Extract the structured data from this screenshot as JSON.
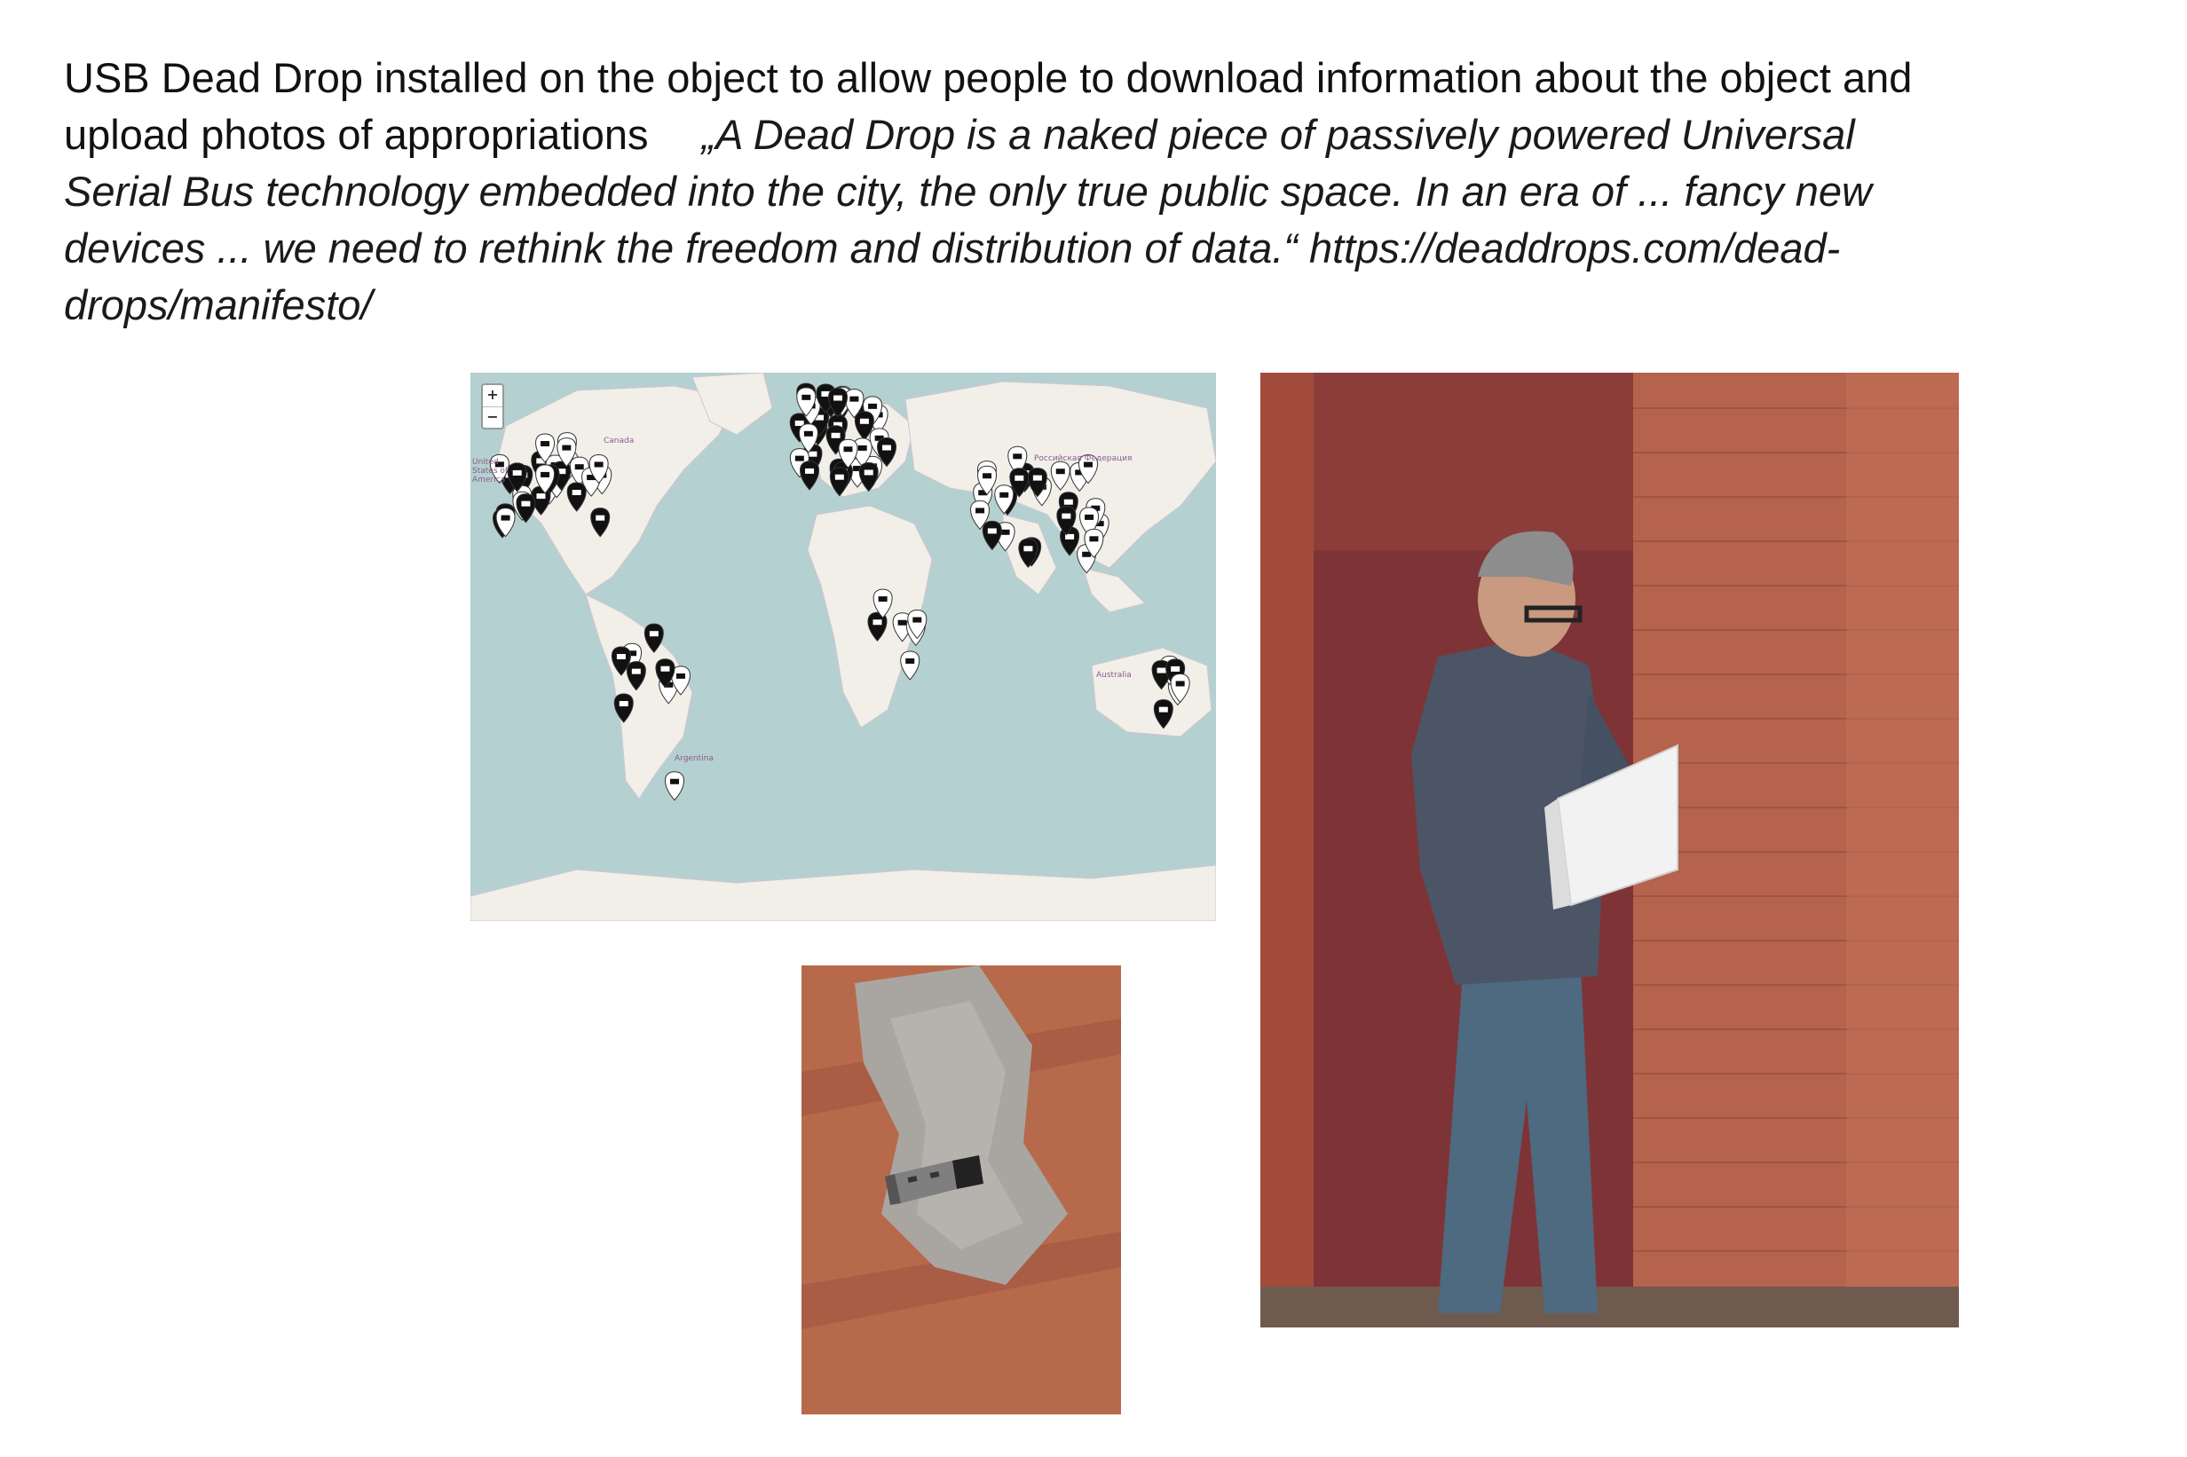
{
  "text": {
    "caption_line1": "USB Dead Drop installed on the object to allow people to download information about the object and",
    "caption_line2": "upload photos of appropriations",
    "quote_line1": "„A Dead Drop is a naked piece of passively powered Universal",
    "quote_line2": "Serial Bus technology embedded into the city, the only true public space. In an era of ... fancy new",
    "quote_line3": "devices ... we need to rethink the freedom and distribution of data.“ https://deaddrops.com/dead-",
    "quote_line4": "drops/manifesto/"
  },
  "map": {
    "zoom_in": "+",
    "zoom_out": "−",
    "labels": {
      "canada": "Canada",
      "usa": "United States of America",
      "russia": "Российская Федерация",
      "argentina": "Argentina",
      "australia": "Australia"
    },
    "colors": {
      "ocean": "#b5d0d0",
      "land": "#f2efe9",
      "marker": "#111111",
      "marker_face": "#ffffff"
    }
  },
  "photos": {
    "man_with_laptop": "man-with-laptop-photo",
    "usb_in_wall": "usb-in-wall-photo"
  }
}
